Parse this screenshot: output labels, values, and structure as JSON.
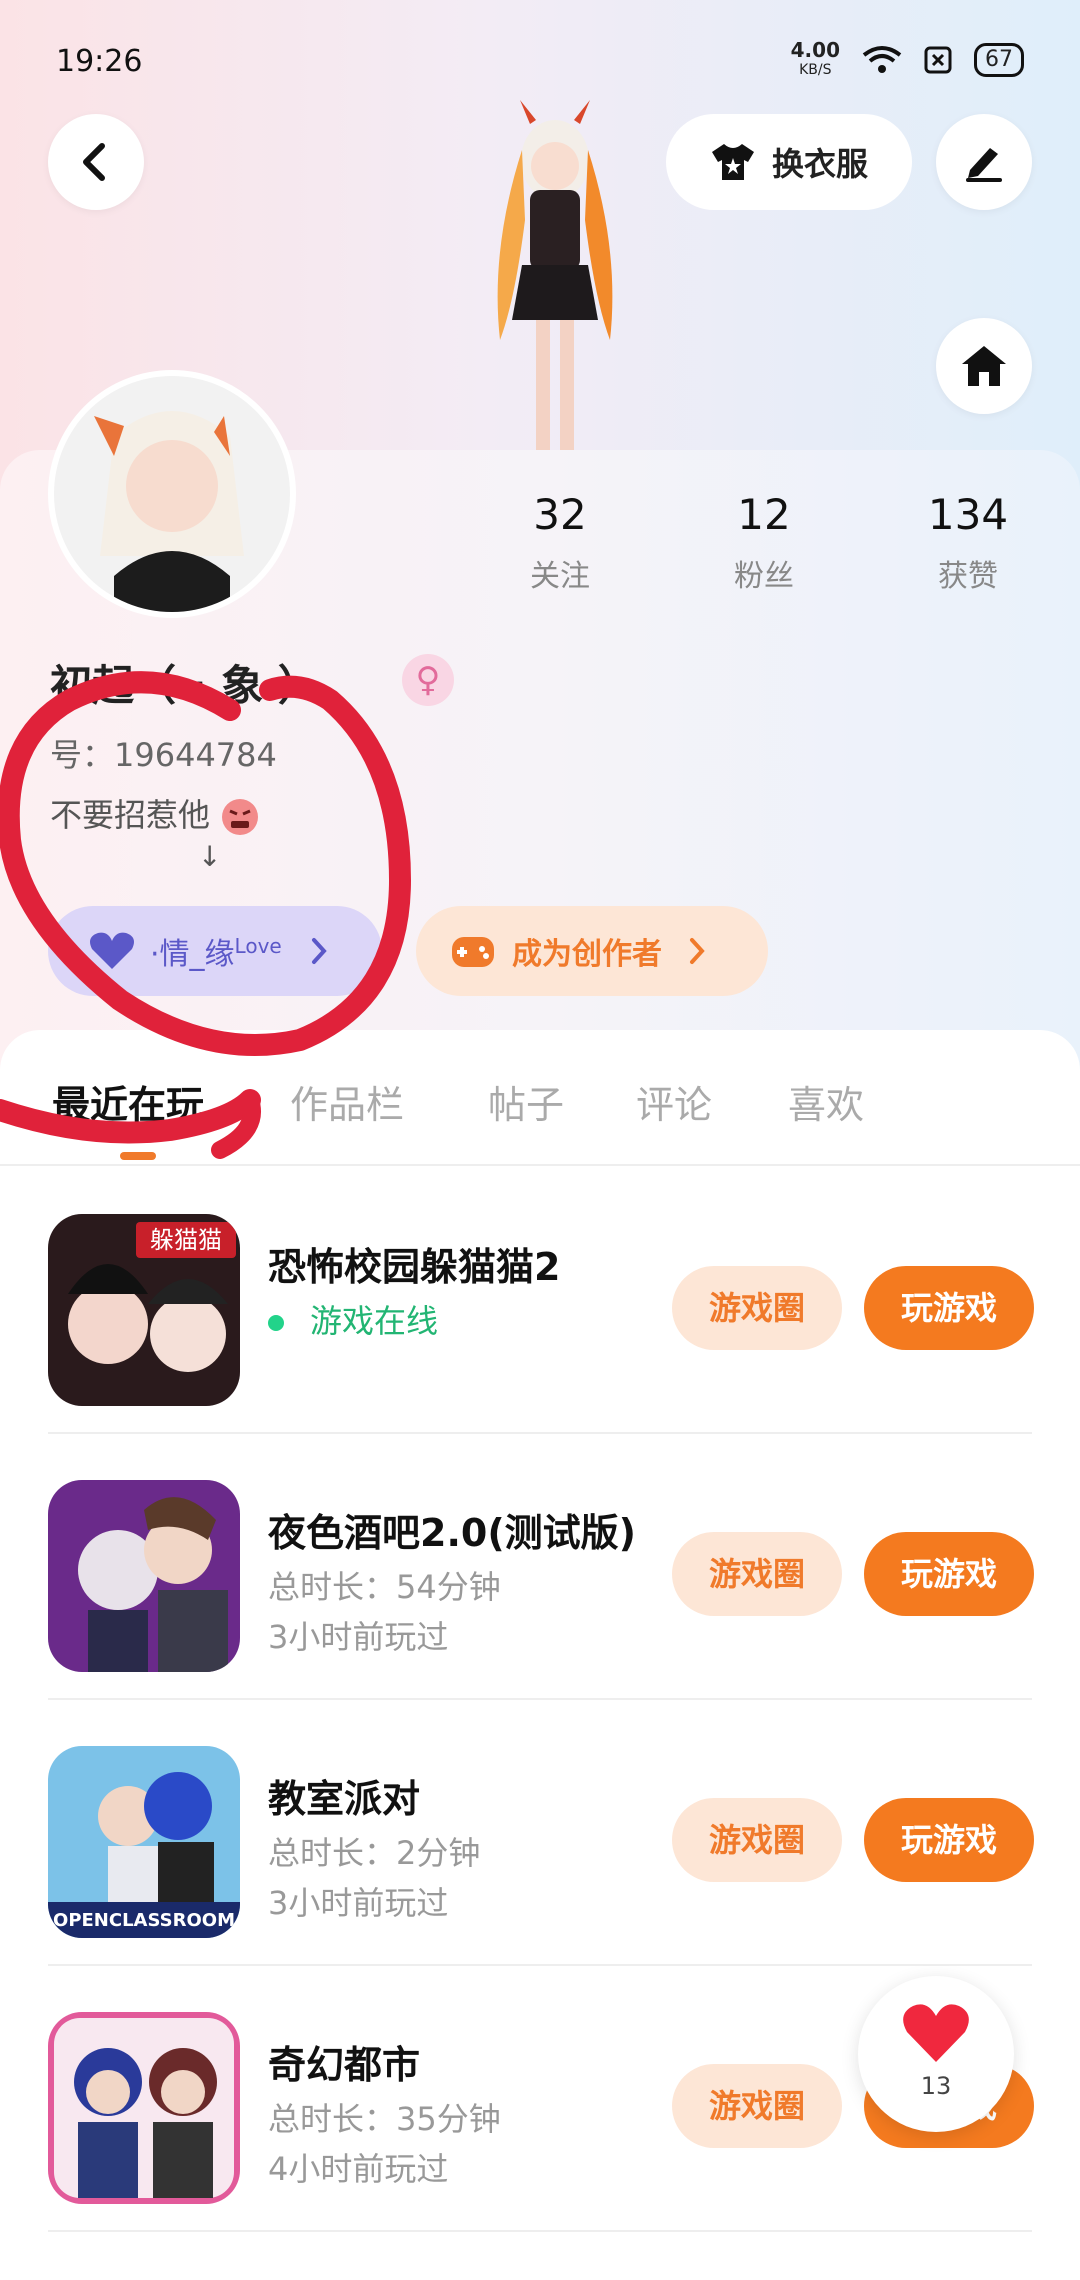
{
  "status_bar": {
    "time": "19:26",
    "net_speed": "4.00",
    "net_unit": "KB/S",
    "battery": "67"
  },
  "header": {
    "outfit_label": "换衣服"
  },
  "profile": {
    "stats": [
      {
        "value": "32",
        "label": "关注"
      },
      {
        "value": "12",
        "label": "粉丝"
      },
      {
        "value": "134",
        "label": "获赞"
      }
    ],
    "nickname": "初起（  ·  象 ）",
    "gender_symbol": "♀",
    "uid": "  号：19644784",
    "bio": "不要招惹他",
    "bio_arrow": "↓",
    "love_badge": "·情_缘",
    "love_sup": "Love",
    "creator_label": "成为创作者"
  },
  "tabs": [
    "最近在玩",
    "作品栏",
    "帖子",
    "评论",
    "喜欢"
  ],
  "games": [
    {
      "name": "恐怖校园躲猫猫2",
      "line1": "游戏在线",
      "line2": "",
      "online": true,
      "icon_text": "躲猫猫",
      "circle_label": "游戏圈",
      "play_label": "玩游戏"
    },
    {
      "name": "夜色酒吧2.0(测试版)",
      "line1": "总时长：54分钟",
      "line2": "3小时前玩过",
      "online": false,
      "icon_text": "",
      "circle_label": "游戏圈",
      "play_label": "玩游戏"
    },
    {
      "name": "教室派对",
      "line1": "总时长：2分钟",
      "line2": "3小时前玩过",
      "online": false,
      "icon_text": "OPENCLASSROOM",
      "circle_label": "游戏圈",
      "play_label": "玩游戏"
    },
    {
      "name": "奇幻都市",
      "line1": "总时长：35分钟",
      "line2": "4小时前玩过",
      "online": false,
      "icon_text": "",
      "circle_label": "游戏圈",
      "play_label": "玩游戏"
    }
  ],
  "like_float": {
    "count": "13"
  },
  "colors": {
    "accent": "#f47a1f",
    "accent_light": "#fde6d6",
    "love_bg": "#dcd6f8",
    "love_fg": "#5b58c8",
    "online": "#22b573",
    "scribble": "#e0223a"
  },
  "icons": [
    "back-icon",
    "tshirt-icon",
    "edit-icon",
    "home-icon",
    "female-icon",
    "heart-icon",
    "gamepad-icon",
    "chevron-right-icon",
    "wifi-icon"
  ]
}
